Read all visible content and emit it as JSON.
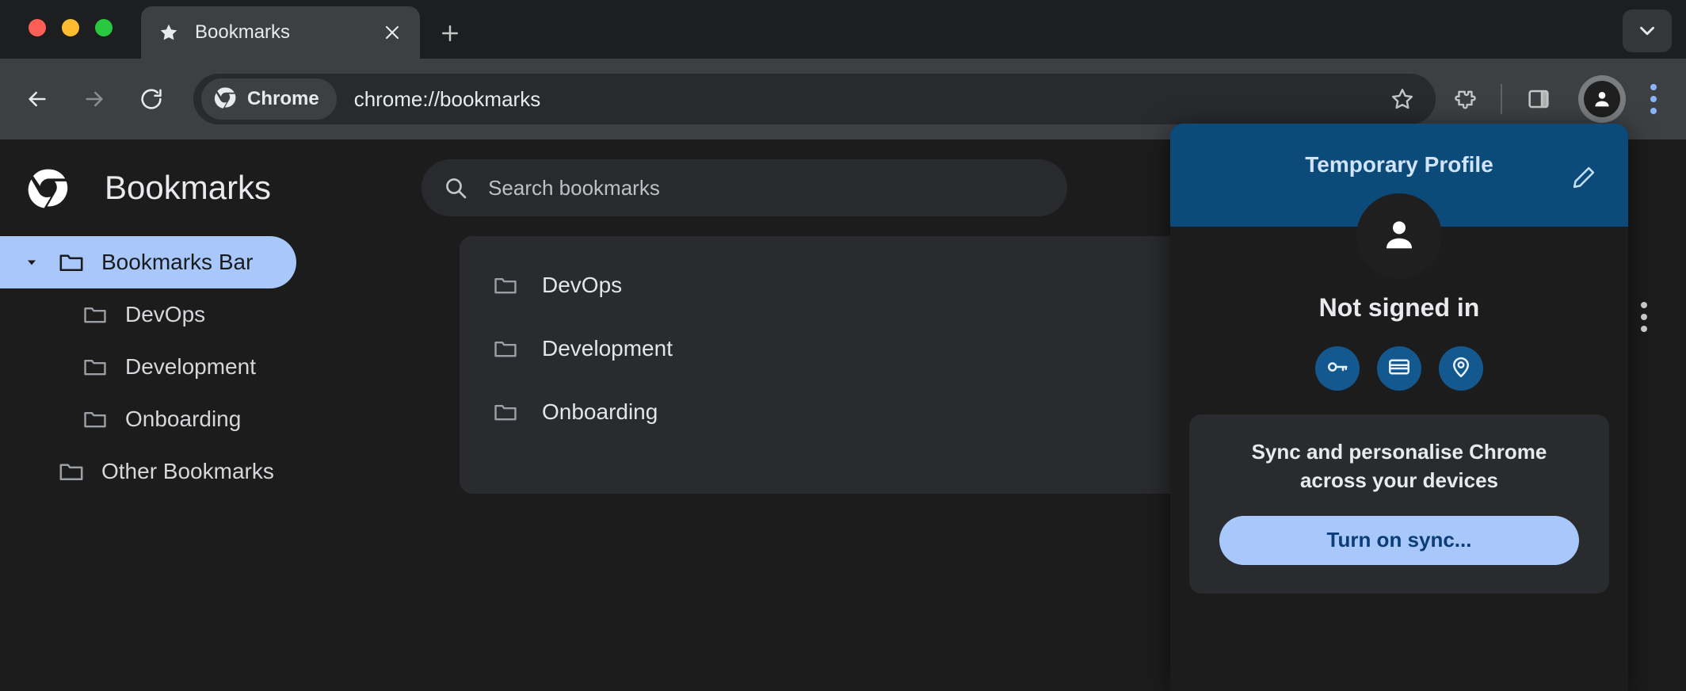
{
  "window": {
    "traffic_lights": [
      "close",
      "minimize",
      "zoom"
    ]
  },
  "tabstrip": {
    "tab": {
      "favicon": "star-icon",
      "title": "Bookmarks",
      "close_label": "✕"
    },
    "new_tab_label": "+",
    "chevron_icon": "chevron-down-icon"
  },
  "toolbar": {
    "back_icon": "arrow-back-icon",
    "forward_icon": "arrow-forward-icon",
    "reload_icon": "reload-icon",
    "chrome_chip_label": "Chrome",
    "url": "chrome://bookmarks",
    "bookmark_star_icon": "star-outline-icon",
    "extensions_icon": "puzzle-piece-icon",
    "side_panel_icon": "side-panel-icon",
    "avatar_icon": "person-icon",
    "menu_icon": "three-dot-menu-icon"
  },
  "page": {
    "logo": "chrome-logo-icon",
    "title": "Bookmarks",
    "search": {
      "icon": "search-icon",
      "placeholder": "Search bookmarks",
      "value": ""
    },
    "menu_icon": "three-dot-menu-icon",
    "sidebar": {
      "items": [
        {
          "label": "Bookmarks Bar",
          "level": 1,
          "selected": true,
          "expanded": true
        },
        {
          "label": "DevOps",
          "level": 2,
          "selected": false,
          "expanded": false
        },
        {
          "label": "Development",
          "level": 2,
          "selected": false,
          "expanded": false
        },
        {
          "label": "Onboarding",
          "level": 2,
          "selected": false,
          "expanded": false
        },
        {
          "label": "Other Bookmarks",
          "level": 1,
          "selected": false,
          "expanded": false
        }
      ]
    },
    "list": {
      "rows": [
        {
          "label": "DevOps"
        },
        {
          "label": "Development"
        },
        {
          "label": "Onboarding"
        }
      ]
    }
  },
  "profile_panel": {
    "header_title": "Temporary Profile",
    "edit_icon": "pencil-edit-icon",
    "avatar_icon": "person-icon",
    "status": "Not signed in",
    "actions": [
      {
        "name": "passwords",
        "icon": "key-icon"
      },
      {
        "name": "payment-methods",
        "icon": "credit-card-icon"
      },
      {
        "name": "addresses",
        "icon": "location-pin-icon"
      }
    ],
    "sync_text": "Sync and personalise Chrome across your devices",
    "sync_button_label": "Turn on sync..."
  },
  "colors": {
    "accent_blue": "#a8c7fa",
    "profile_header_blue": "#0b4a79",
    "action_circle_blue": "#13598f",
    "sync_button_text": "#0b3d78",
    "window_bg": "#1c1c1c",
    "toolbar_bg": "#3c4043",
    "card_bg": "#2a2b2e"
  }
}
